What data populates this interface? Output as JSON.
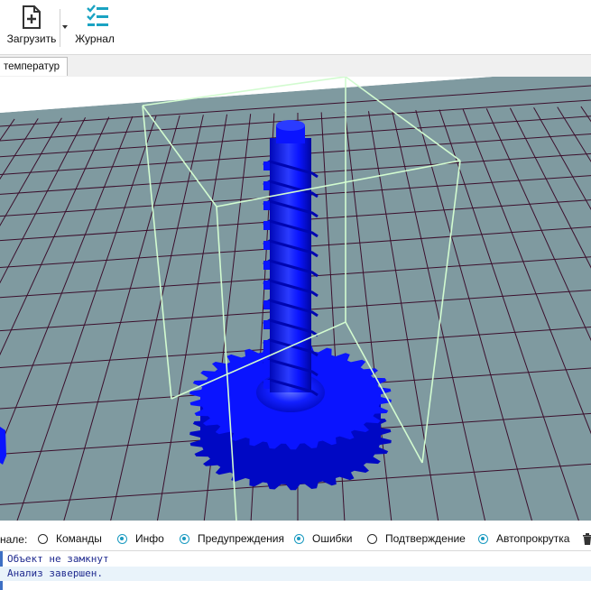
{
  "toolbar": {
    "load_label": "Загрузить",
    "journal_label": "Журнал"
  },
  "tabs": [
    {
      "label": "температур"
    }
  ],
  "viewport": {
    "background": "#7f9aa0",
    "grid_color": "#3b0f2c",
    "model_color": "#0a14ff",
    "bbox_color": "#d2fbd0"
  },
  "filter_bar": {
    "lead_label": "нале:",
    "options": [
      {
        "label": "Команды",
        "checked": false
      },
      {
        "label": "Инфо",
        "checked": true
      },
      {
        "label": "Предупреждения",
        "checked": true
      },
      {
        "label": "Ошибки",
        "checked": true
      },
      {
        "label": "Подтверждение",
        "checked": false
      },
      {
        "label": "Автопрокрутка",
        "checked": true
      }
    ]
  },
  "log": {
    "lines": [
      "Объект не замкнут",
      "Анализ завершен."
    ]
  }
}
